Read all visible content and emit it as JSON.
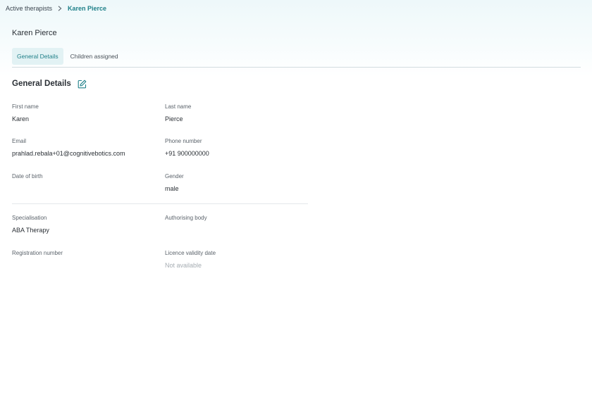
{
  "breadcrumb": {
    "parent": "Active therapists",
    "current": "Karen Pierce"
  },
  "page": {
    "title": "Karen Pierce"
  },
  "tabs": [
    {
      "label": "General Details",
      "active": true
    },
    {
      "label": "Children assigned",
      "active": false
    }
  ],
  "section": {
    "title": "General Details",
    "edit_icon": "edit-icon"
  },
  "fields": {
    "first_name": {
      "label": "First name",
      "value": "Karen"
    },
    "last_name": {
      "label": "Last name",
      "value": "Pierce"
    },
    "email": {
      "label": "Email",
      "value": "prahlad.rebala+01@cognitivebotics.com"
    },
    "phone": {
      "label": "Phone number",
      "value": "+91 900000000"
    },
    "dob": {
      "label": "Date of birth",
      "value": ""
    },
    "gender": {
      "label": "Gender",
      "value": "male"
    },
    "specialisation": {
      "label": "Specialisation",
      "value": "ABA Therapy"
    },
    "authorising_body": {
      "label": "Authorising body",
      "value": ""
    },
    "registration_number": {
      "label": "Registration number",
      "value": ""
    },
    "licence_validity": {
      "label": "Licence validity date",
      "value": "Not available"
    }
  },
  "colors": {
    "accent": "#1f8089",
    "tab_active_bg": "#e2f2f4",
    "muted_text": "#a6adb3"
  }
}
